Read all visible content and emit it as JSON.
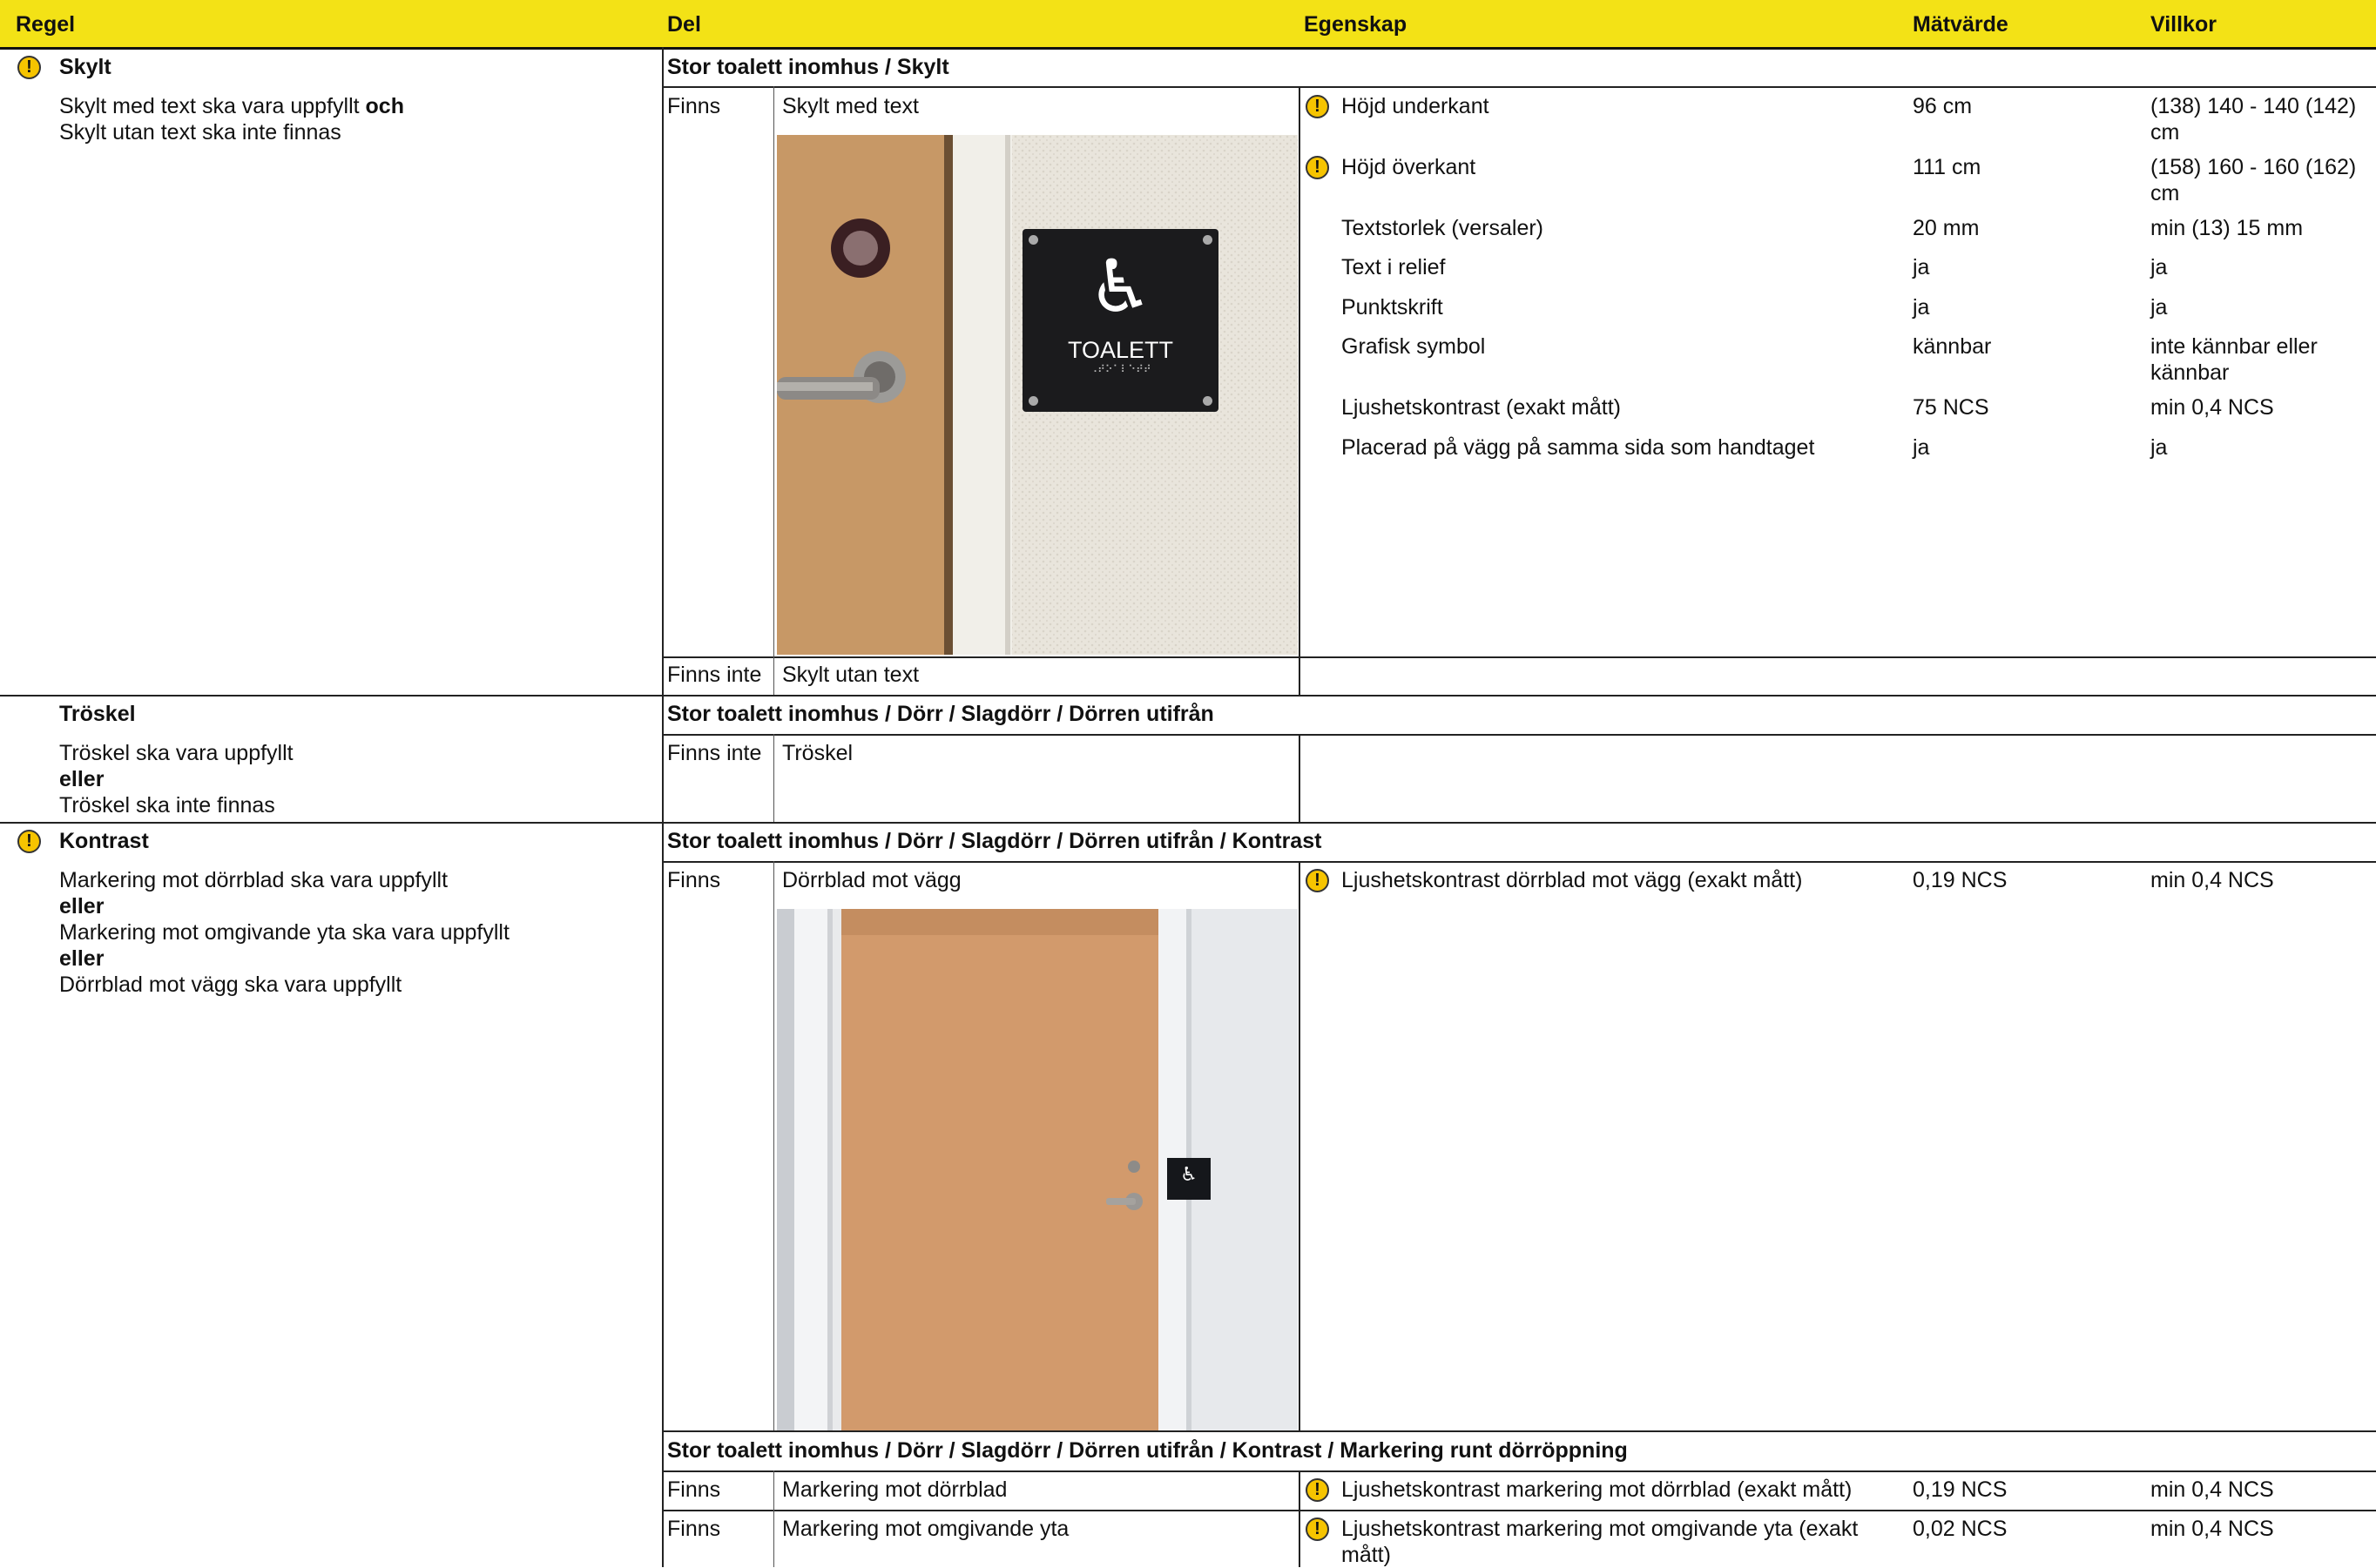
{
  "header": {
    "regel": "Regel",
    "del": "Del",
    "egenskap": "Egenskap",
    "matvarde": "Mätvärde",
    "villkor": "Villkor"
  },
  "warning_glyph": "!",
  "colors": {
    "header_bg": "#f3e216",
    "warning": "#f6c400"
  },
  "rules": {
    "skylt": {
      "title": "Skylt",
      "line1_a": "Skylt med text ska vara uppfyllt ",
      "line1_b": "och",
      "line2": "Skylt utan text ska inte finnas"
    },
    "troskel": {
      "title": "Tröskel",
      "line1": "Tröskel ska vara uppfyllt",
      "or1": "eller",
      "line2": "Tröskel ska inte finnas"
    },
    "kontrast": {
      "title": "Kontrast",
      "line1": "Markering mot dörrblad ska vara uppfyllt",
      "or1": "eller",
      "line2": "Markering mot omgivande yta ska vara uppfyllt",
      "or2": "eller",
      "line3": "Dörrblad mot vägg ska vara uppfyllt"
    }
  },
  "sections": {
    "skylt": {
      "path": "Stor toalett inomhus / Skylt",
      "row1": {
        "status": "Finns",
        "part": "Skylt med text",
        "sign_text": "TOALETT",
        "braille": "⠠⠞⠕⠁⠇⠑⠞⠞"
      },
      "row2": {
        "status": "Finns inte",
        "part": "Skylt utan text"
      },
      "props": [
        {
          "name": "Höjd underkant",
          "value": "96 cm",
          "cond": "(138) 140 - 140 (142) cm",
          "warn": true
        },
        {
          "name": "Höjd överkant",
          "value": "111 cm",
          "cond": "(158) 160 - 160 (162) cm",
          "warn": true
        },
        {
          "name": "Textstorlek (versaler)",
          "value": "20 mm",
          "cond": "min (13) 15 mm",
          "warn": false
        },
        {
          "name": "Text i relief",
          "value": "ja",
          "cond": "ja",
          "warn": false
        },
        {
          "name": "Punktskrift",
          "value": "ja",
          "cond": "ja",
          "warn": false
        },
        {
          "name": "Grafisk symbol",
          "value": "kännbar",
          "cond": "inte kännbar eller kännbar",
          "warn": false
        },
        {
          "name": "Ljushetskontrast (exakt mått)",
          "value": "75 NCS",
          "cond": "min 0,4 NCS",
          "warn": false
        },
        {
          "name": "Placerad på vägg på samma sida som handtaget",
          "value": "ja",
          "cond": "ja",
          "warn": false
        }
      ]
    },
    "troskel": {
      "path": "Stor toalett inomhus / Dörr / Slagdörr / Dörren utifrån",
      "row1": {
        "status": "Finns inte",
        "part": "Tröskel"
      }
    },
    "kontrast": {
      "path": "Stor toalett inomhus / Dörr / Slagdörr / Dörren utifrån / Kontrast",
      "row1": {
        "status": "Finns",
        "part": "Dörrblad mot vägg"
      },
      "prop1": {
        "name": "Ljushetskontrast dörrblad mot vägg (exakt mått)",
        "value": "0,19 NCS",
        "cond": "min 0,4 NCS"
      },
      "sub_path": "Stor toalett inomhus / Dörr / Slagdörr / Dörren utifrån / Kontrast / Markering runt dörröppning",
      "row2": {
        "status": "Finns",
        "part": "Markering mot dörrblad"
      },
      "prop2": {
        "name": "Ljushetskontrast markering mot dörrblad (exakt mått)",
        "value": "0,19 NCS",
        "cond": "min 0,4 NCS"
      },
      "row3": {
        "status": "Finns",
        "part": "Markering mot omgivande yta"
      },
      "prop3": {
        "name": "Ljushetskontrast markering mot omgivande yta (exakt mått)",
        "value": "0,02 NCS",
        "cond": "min 0,4 NCS"
      }
    }
  }
}
